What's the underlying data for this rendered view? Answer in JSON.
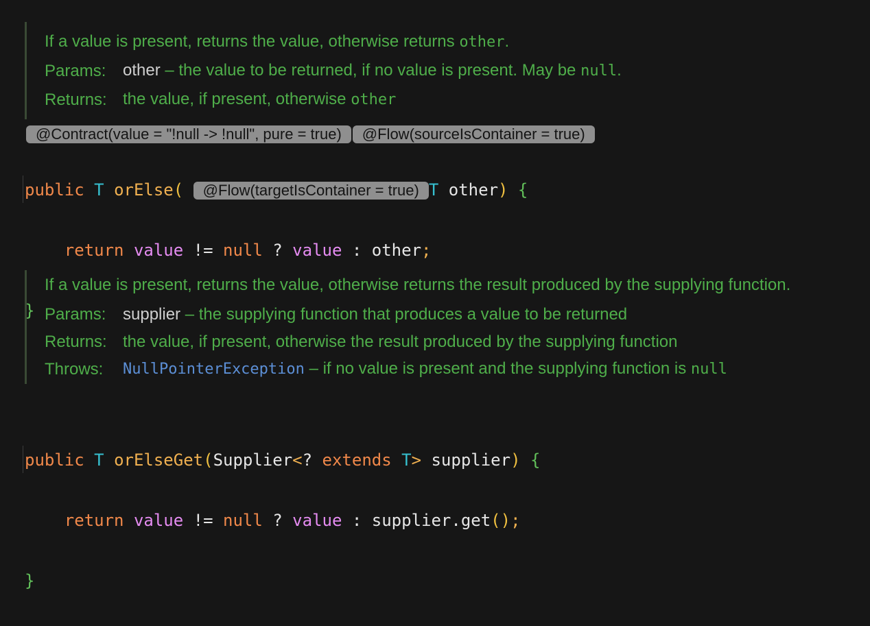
{
  "doc1": {
    "summary_text": "If a value is present, returns the value, otherwise returns ",
    "summary_code": "other",
    "summary_end": ".",
    "params_label": "Params:",
    "params_name": "other",
    "params_desc": " – the value to be returned, if no value is present. May be ",
    "params_code": "null",
    "params_end": ".",
    "returns_label": "Returns:",
    "returns_text": "the value, if present, otherwise ",
    "returns_code": "other"
  },
  "hints": {
    "contract": "@Contract(value = \"!null -> !null\", pure = true)",
    "flow_source": "@Flow(sourceIsContainer = true)",
    "flow_target": "@Flow(targetIsContainer = true)"
  },
  "code1": {
    "public": "public",
    "type": "T",
    "method": "orElse",
    "open_paren": "(",
    "param_type": "T",
    "param_name": "other",
    "close_paren": ")",
    "open_brace": "{",
    "return": "return",
    "value": "value",
    "neq": "!=",
    "null": "null",
    "q": "?",
    "value2": "value",
    "colon": ":",
    "other": "other",
    "semi": ";",
    "close_brace": "}"
  },
  "doc2": {
    "summary": "If a value is present, returns the value, otherwise returns the result produced by the supplying function.",
    "params_label": "Params:",
    "params_name": "supplier",
    "params_desc": " – the supplying function that produces a value to be returned",
    "returns_label": "Returns:",
    "returns_text": "the value, if present, otherwise the result produced by the supplying function",
    "throws_label": "Throws:",
    "throws_link": "NullPointerException",
    "throws_desc": " – if no value is present and the supplying function is ",
    "throws_code": "null"
  },
  "code2": {
    "public": "public",
    "type": "T",
    "method": "orElseGet",
    "open_paren": "(",
    "supplier_type": "Supplier",
    "generic_open": "<",
    "wildcard": "?",
    "extends": "extends",
    "generic_t": "T",
    "generic_close": ">",
    "param_name": "supplier",
    "close_paren": ")",
    "open_brace": "{",
    "return": "return",
    "value": "value",
    "neq": "!=",
    "null": "null",
    "q": "?",
    "value2": "value",
    "colon": ":",
    "call": "supplier.get",
    "call_parens": "()",
    "semi": ";",
    "close_brace": "}"
  }
}
